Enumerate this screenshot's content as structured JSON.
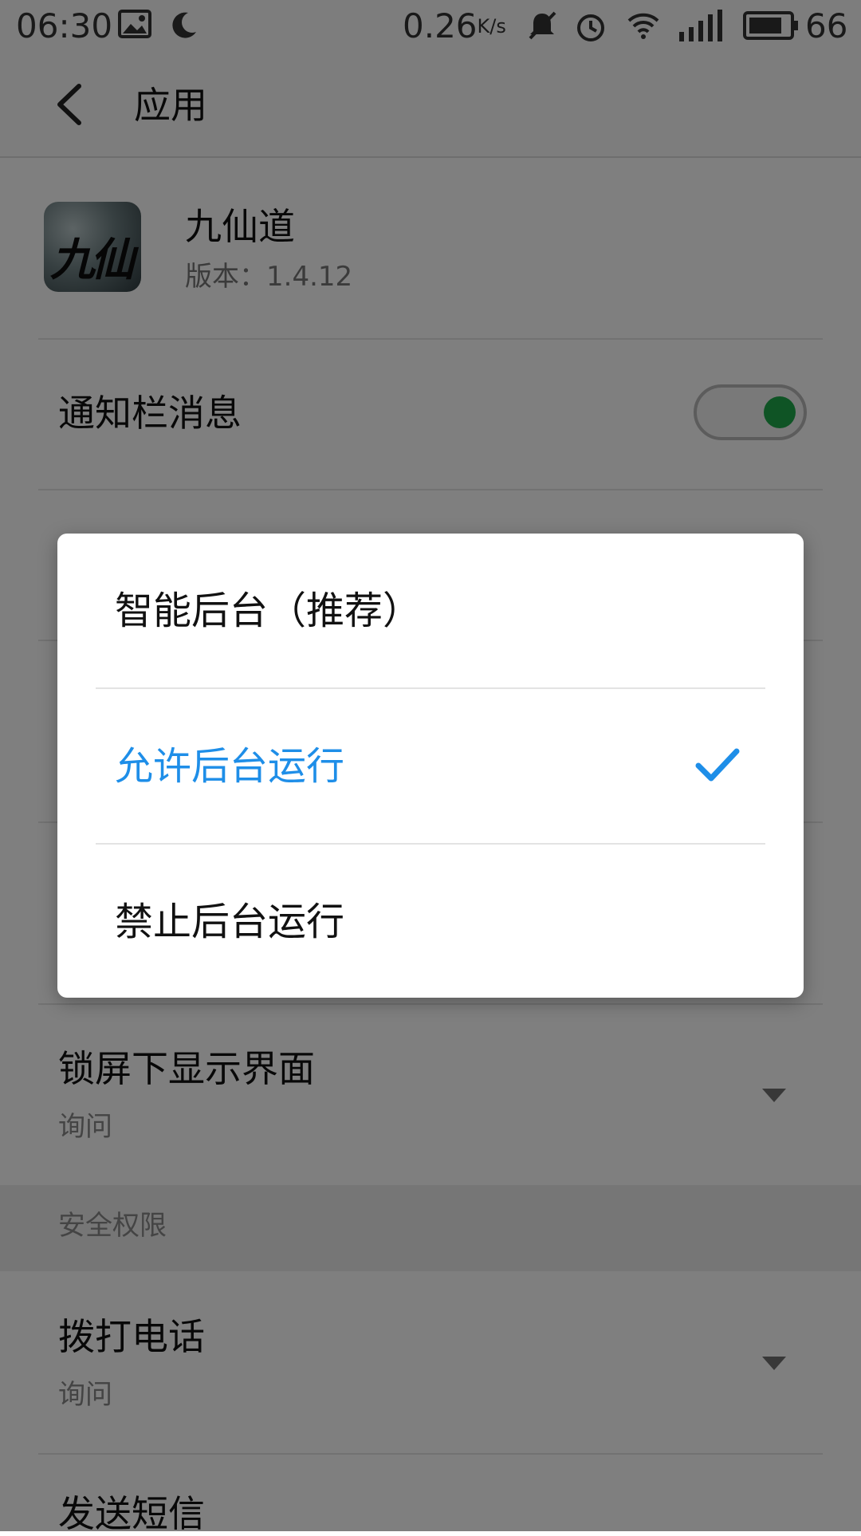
{
  "status_bar": {
    "time": "06:30",
    "net_speed": "0.26",
    "net_speed_unit": "K/s",
    "battery": "66",
    "icons": [
      "gallery-icon",
      "moon-icon",
      "mute-icon",
      "alarm-icon",
      "wifi-icon",
      "signal-4g-icon",
      "battery-icon"
    ]
  },
  "app_bar": {
    "title": "应用"
  },
  "app_info": {
    "name": "九仙道",
    "version": "版本：1.4.12",
    "logo_text": "九仙道"
  },
  "settings": {
    "notification": {
      "title": "通知栏消息",
      "enabled": true
    },
    "lockscreen": {
      "title": "锁屏下显示界面",
      "value": "询问"
    },
    "security_section": "安全权限",
    "call": {
      "title": "拨打电话",
      "value": "询问"
    },
    "sms": {
      "title": "发送短信"
    }
  },
  "dialog": {
    "options": [
      {
        "label": "智能后台（推荐）",
        "selected": false
      },
      {
        "label": "允许后台运行",
        "selected": true
      },
      {
        "label": "禁止后台运行",
        "selected": false
      }
    ]
  },
  "colors": {
    "accent": "#1e8ee8",
    "toggle_on": "#1fa94a",
    "scrim": "rgba(0,0,0,0.5)"
  }
}
